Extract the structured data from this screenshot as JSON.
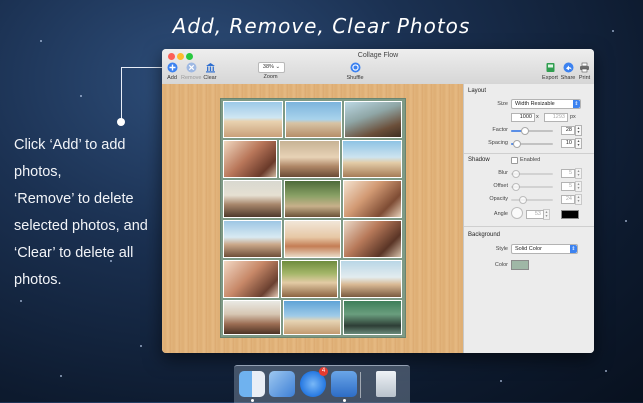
{
  "headline": "Add, Remove, Clear Photos",
  "caption_lines": [
    "Click ‘Add’ to add photos,",
    "‘Remove’ to delete",
    "selected photos, and",
    "‘Clear’ to delete all photos."
  ],
  "window": {
    "title": "Collage Flow",
    "toolbar": {
      "add": "Add",
      "remove": "Remove",
      "clear": "Clear",
      "zoom_value": "38%",
      "zoom_label": "Zoom",
      "shuffle": "Shuffle",
      "export": "Export",
      "share": "Share",
      "print": "Print"
    }
  },
  "inspector": {
    "layout_title": "Layout",
    "size_label": "Size",
    "size_value": "Width Resizable",
    "width": "1000",
    "x_sep": "x",
    "height": "1293",
    "unit": "px",
    "factor_label": "Factor",
    "factor_value": "28",
    "spacing_label": "Spacing",
    "spacing_value": "10",
    "shadow_title": "Shadow",
    "enabled_label": "Enabled",
    "blur_label": "Blur",
    "blur_value": "5",
    "offset_label": "Offset",
    "offset_value": "5",
    "opacity_label": "Opacity",
    "opacity_value": "24",
    "angle_label": "Angle",
    "angle_value": "53",
    "background_title": "Background",
    "style_label": "Style",
    "style_value": "Solid Color",
    "color_label": "Color"
  },
  "colors": {
    "accent": "#3c82f0",
    "wood": "#e2b47c",
    "collage_frame": "#7e9a86",
    "bg_swatch": "#9fb7a6"
  },
  "dock": {
    "app_store_badge": "4"
  }
}
